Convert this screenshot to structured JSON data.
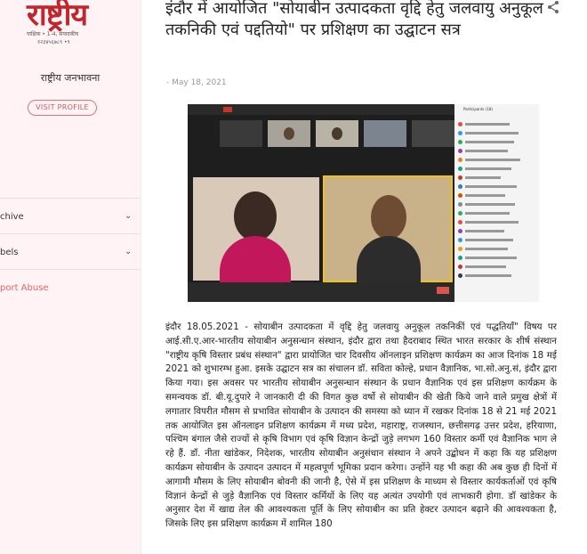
{
  "sidebar": {
    "logo_text": "राष्ट्रीय",
    "logo_sub": "पाक्षिक • 1-4, संपादकीय",
    "logo_sub2": "१२३४५६७८९ •९",
    "blog_name": "राष्ट्रीय जनभावना",
    "visit_profile": "VISIT PROFILE",
    "archive": "chive",
    "labels": "bels",
    "report": "port Abuse"
  },
  "post": {
    "title": "इंदौर में आयोजित \"सोयाबीन उत्पादकता वृद्दि हेतु जलवायु अनुकूल तकनिकी एवं पद्दतियो\" पर प्रशिक्षण का उद्घाटन सत्र",
    "date": "- May 18, 2021",
    "body": "इंदौर 18.05.2021 - सोयाबीन उत्पादकता में वृद्दि हेतु जलवायु अनुकूल तकनिकीं एवं पद्धतियाँ\" विषय पर आई.सी.ए.आर-भारतीय सोयाबीन अनुसन्धान संस्थान, इंदौर द्वारा तथा हैदराबाद स्थित भारत सरकार के शीर्ष संस्थान \"राष्ट्रीय कृषि विस्तार प्रबंध संस्थान\" द्वारा प्रायोजित चार दिवसीय ऑनलाइन प्रशिक्षण कार्यक्रम का आज दिनांक 18 मई 2021 को शुभारम्भ हुआ. इसके उद्घाटन सत्र का संचालन डॉ. सविता कोल्हे, प्रधान वैज्ञानिक, भा.सो.अनु.सं, इंदौर द्वारा किया गया। इस अवसर पर भारतीय सोयाबीन अनुसन्धान संस्थान के प्रधान वैज्ञानिक एवं इस प्रशिक्षण कार्यक्रम के समन्वयक डॉ. बी.यू.दुपारे ने जानकारी दी की विगत कुछ वर्षो से सोयाबीन की खेती किये जाने वाले प्रमुख क्षेत्रों में लगातार विपरीत मौसम से प्रभावित सोयाबीन के उत्पादन की समस्या को ध्यान में रखकर दिनांक 18 से 21 मई 2021 तक आयोजित इस ऑनलाइन प्रशिक्षण कार्यक्रम में मध्य प्रदेश, महाराष्ट्र, राजस्थान, छत्तीसगढ़ उत्तर प्रदेश, हरियाणा, पश्चिम बंगाल जैसे राज्यों से कृषि विभाग एवं कृषि विज्ञान केन्द्रों जुड़े लगभग 160 विस्तार कर्मी एवं वैज्ञानिक भाग ले रहे हैं. डॉ. नीता खांडेकर, निदेशक, भारतीय सोयाबीन अनुसंधान संस्थान ने अपने उद्बोधन में कहा कि यह प्रशिक्षण कार्यक्रम सोयाबीन के उत्पादन उत्पादन में महत्वपूर्ण भूमिका प्रदान करेगा। उन्होंने यह भी कहा की अब कुछ ही दिनों में आगामी मौसम के लिए सोयाबीन बोवनी की जानी है, ऐसे में इस प्रशिक्षण के माध्यम से विस्तार कार्यकर्ताओं एवं कृषि विज्ञानं केन्द्रों से जुड़े वैज्ञानिक एवं विस्तार कर्मियों के लिए यह अत्यंत उपयोगी एवं लाभकारी होगा. डॉ खांडेकर के अनुसार देश में खाद्य तेल की आवश्यकता पूर्ति के लिए सोयाबीन का प्रति हेक्टर उत्पादन बढ़ाने की आवश्यकता है, जिसके लिए इस प्रशिक्षण कार्यक्रम में शामिल 180"
  },
  "video": {
    "panel_title": "Participants (18)"
  },
  "colors": {
    "brand": "#c0262c",
    "accent": "#e57373",
    "sidebar_bg": "#fff3f6"
  }
}
